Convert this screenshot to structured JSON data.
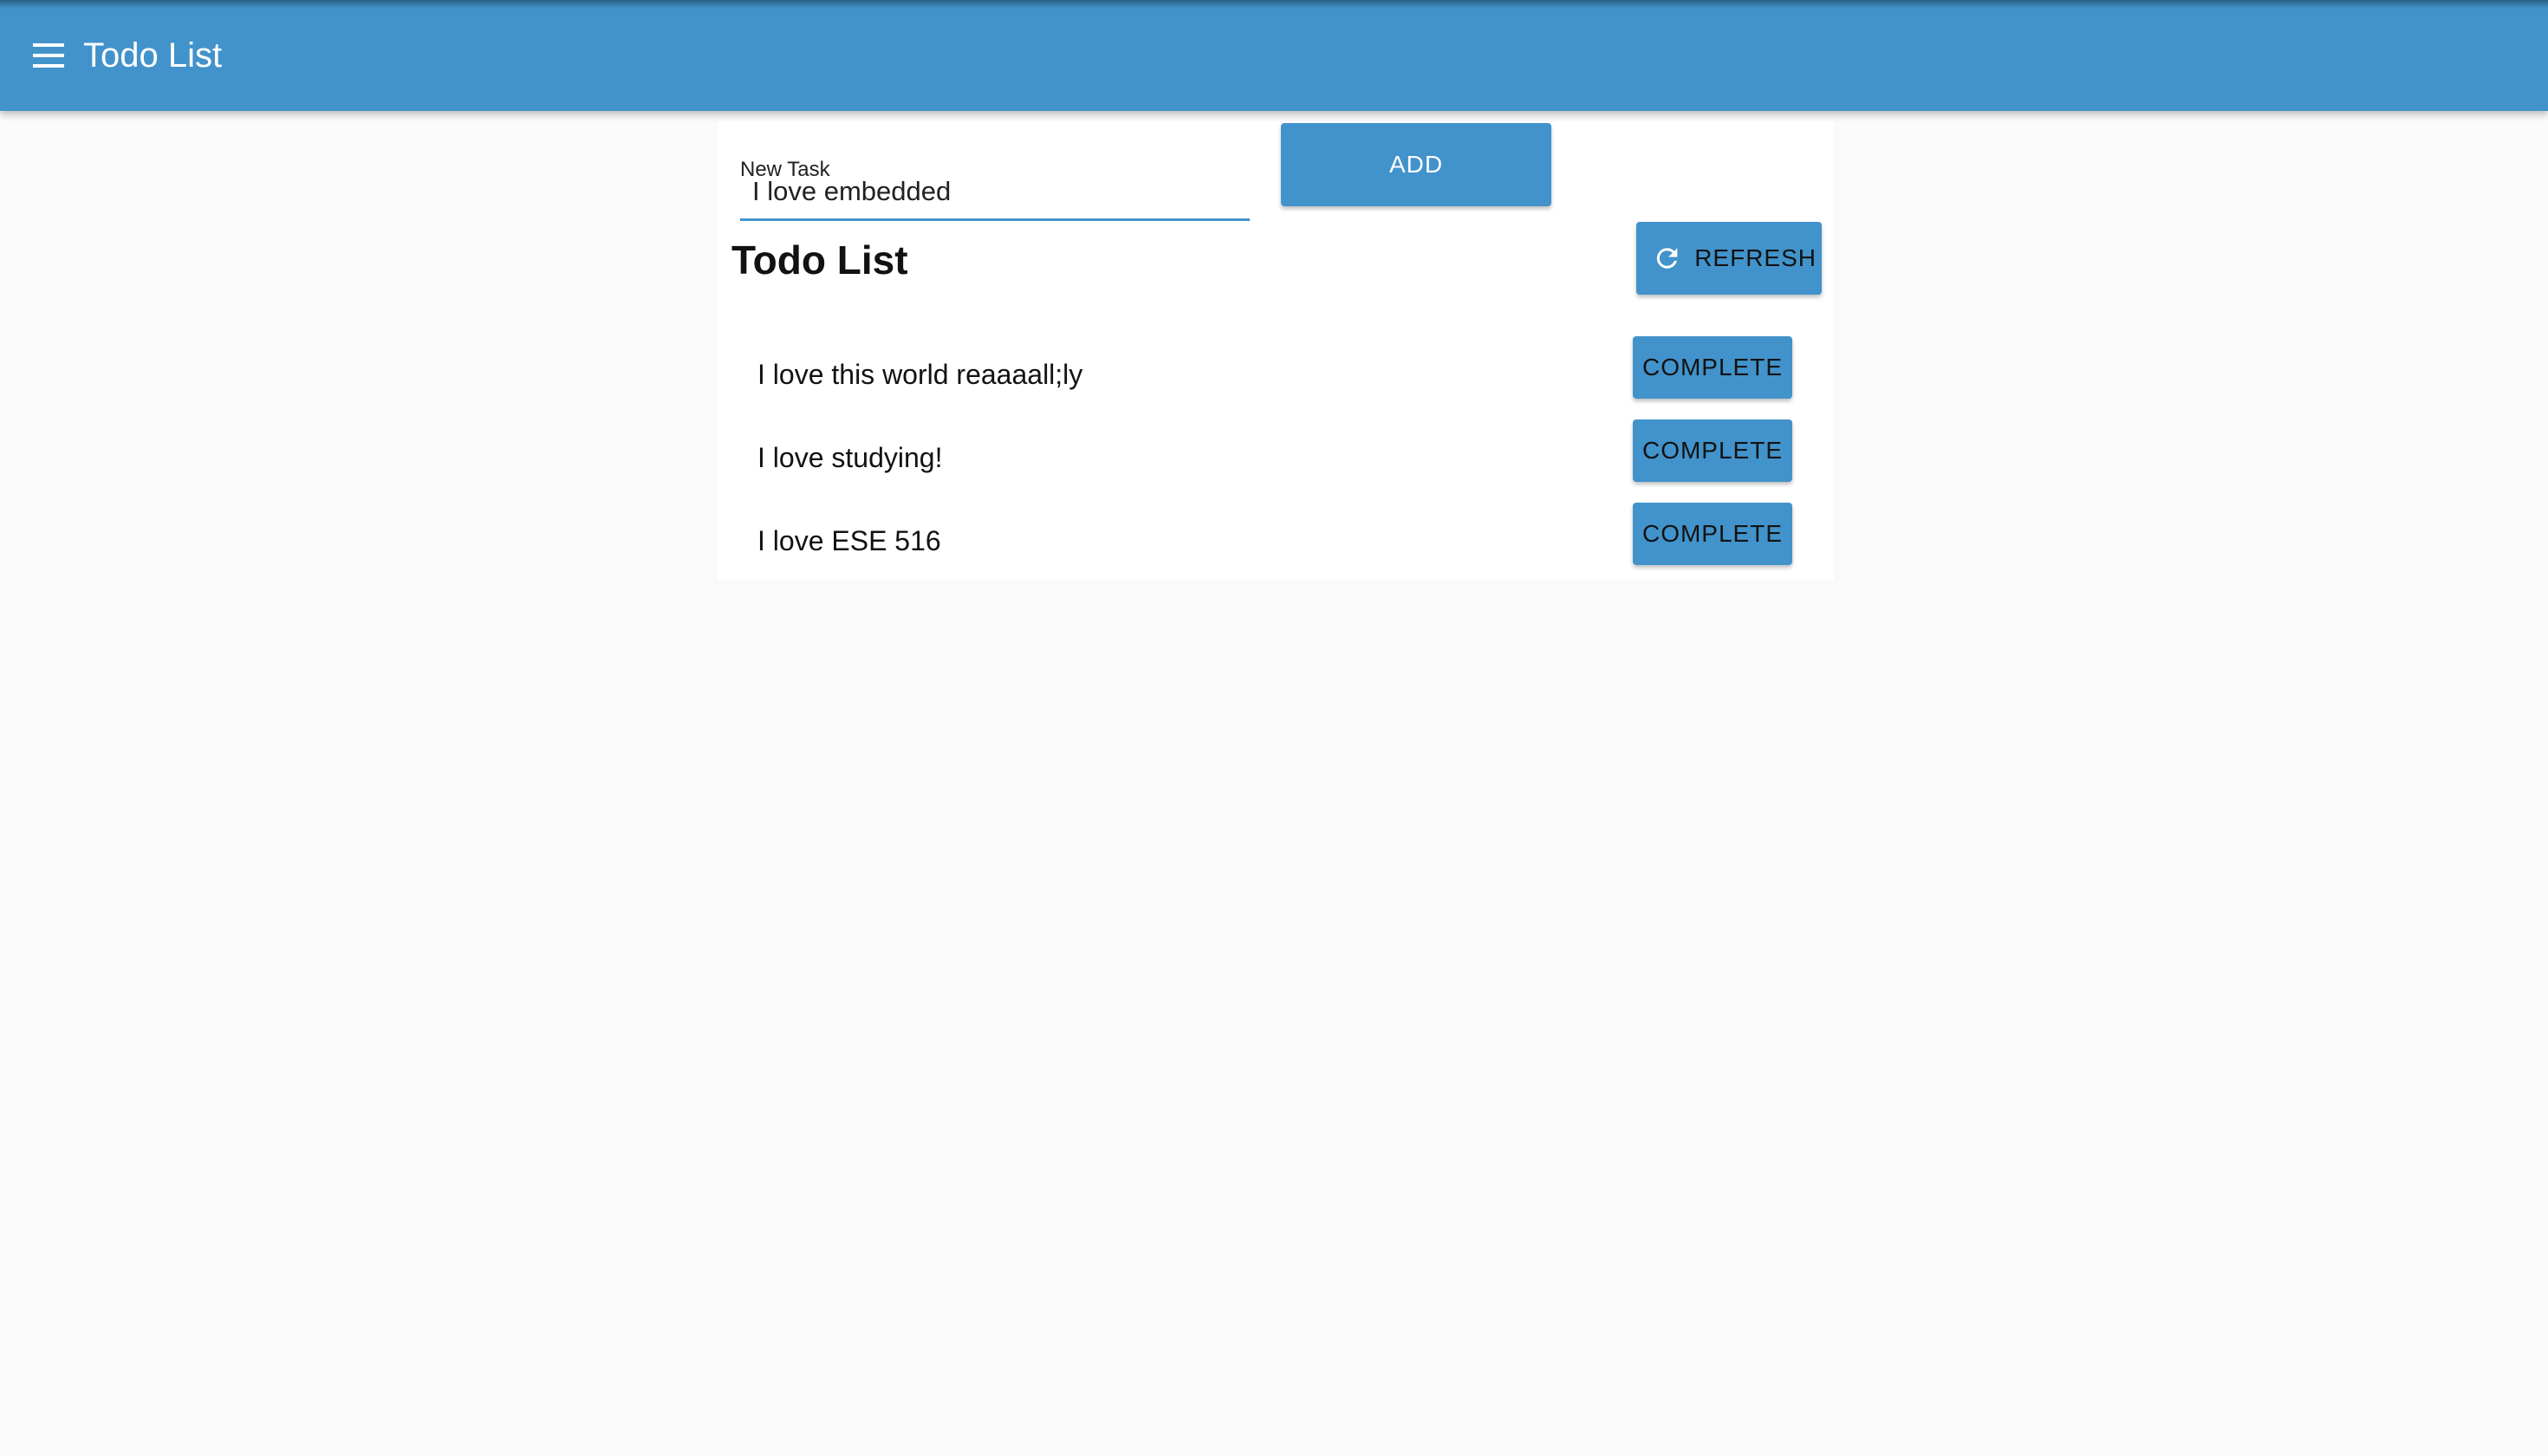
{
  "app_bar": {
    "title": "Todo List",
    "menu_icon": "menu-icon",
    "color": "#4293cb"
  },
  "new_task": {
    "label": "New Task",
    "value": "I love embedded"
  },
  "add_button": {
    "label": "ADD"
  },
  "list": {
    "title": "Todo List",
    "refresh_label": "REFRESH",
    "refresh_icon": "refresh-icon",
    "items": [
      {
        "text": "I love this world reaaaall;ly",
        "button": "COMPLETE"
      },
      {
        "text": "I love studying!",
        "button": "COMPLETE"
      },
      {
        "text": "I love ESE 516",
        "button": "COMPLETE"
      }
    ]
  }
}
